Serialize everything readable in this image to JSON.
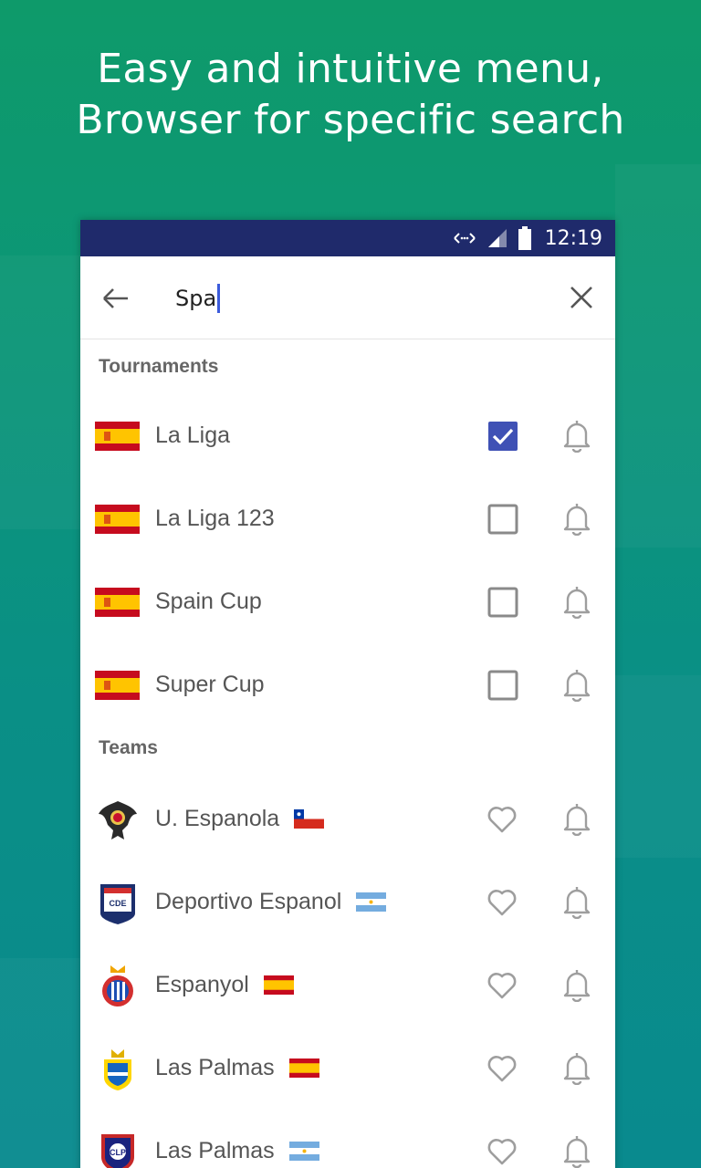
{
  "headline": {
    "line1": "Easy and intuitive menu,",
    "line2": "Browser for specific search"
  },
  "status_bar": {
    "time": "12:19",
    "icons": [
      "data-transfer-icon",
      "signal-icon",
      "battery-icon"
    ]
  },
  "search": {
    "value": "Spa",
    "back_icon": "arrow-left-icon",
    "clear_icon": "close-icon"
  },
  "tournaments": {
    "title": "Tournaments",
    "items": [
      {
        "label": "La Liga",
        "flag": "spain",
        "checked": true
      },
      {
        "label": "La Liga 123",
        "flag": "spain",
        "checked": false
      },
      {
        "label": "Spain Cup",
        "flag": "spain",
        "checked": false
      },
      {
        "label": "Super Cup",
        "flag": "spain",
        "checked": false
      }
    ]
  },
  "teams": {
    "title": "Teams",
    "items": [
      {
        "label": "U. Espanola",
        "country_flag": "chile",
        "crest": "union-espanola-crest"
      },
      {
        "label": "Deportivo Espanol",
        "country_flag": "argentina",
        "crest": "deportivo-espanol-crest"
      },
      {
        "label": "Espanyol",
        "country_flag": "spain",
        "crest": "espanyol-crest"
      },
      {
        "label": "Las Palmas",
        "country_flag": "spain",
        "crest": "las-palmas-crest"
      },
      {
        "label": "Las Palmas",
        "country_flag": "argentina",
        "crest": "las-palmas-arg-crest"
      }
    ]
  },
  "colors": {
    "status_bar": "#1f2a6b",
    "accent": "#3f51b5",
    "icon_grey": "#9e9e9e",
    "text": "#555555"
  }
}
